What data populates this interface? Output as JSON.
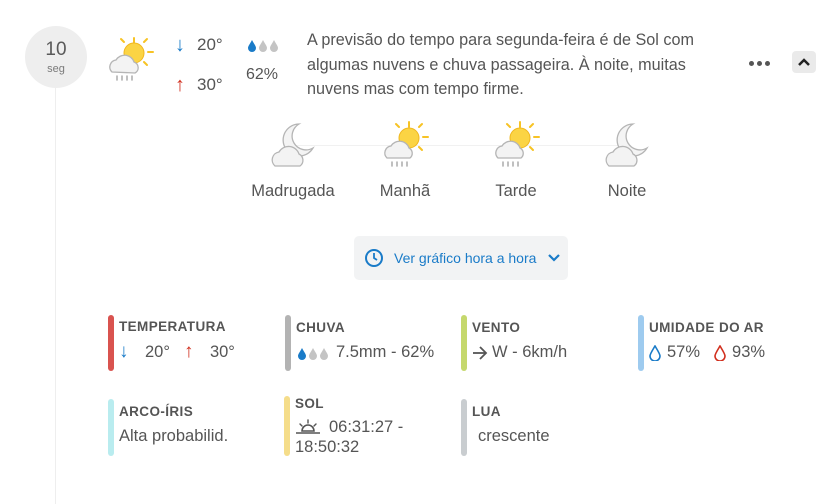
{
  "day": {
    "number": "10",
    "name": "seg"
  },
  "summary": {
    "icon": "sun-cloud-rain-icon",
    "min_temp": "20°",
    "max_temp": "30°",
    "rain_probability": "62%",
    "description": "A previsão do tempo para segunda-feira é de Sol com algumas nuvens e chuva passageira. À noite, muitas nuvens mas com tempo firme."
  },
  "periods": [
    {
      "label": "Madrugada",
      "icon": "moon-cloud-icon"
    },
    {
      "label": "Manhã",
      "icon": "sun-cloud-rain-icon"
    },
    {
      "label": "Tarde",
      "icon": "sun-cloud-rain-icon"
    },
    {
      "label": "Noite",
      "icon": "moon-cloud-icon"
    }
  ],
  "hourly_button": {
    "label": "Ver gráfico hora a hora"
  },
  "stats": {
    "temperature": {
      "title": "TEMPERATURA",
      "min": "20°",
      "max": "30°",
      "color": "#d9534f"
    },
    "rain": {
      "title": "CHUVA",
      "value": "7.5mm - 62%",
      "color": "#b3b3b3"
    },
    "wind": {
      "title": "VENTO",
      "value": "W - 6km/h",
      "color": "#c5d86d"
    },
    "humidity": {
      "title": "UMIDADE DO AR",
      "min": "57%",
      "max": "93%",
      "color": "#9ecbef"
    },
    "rainbow": {
      "title": "ARCO-ÍRIS",
      "value": "Alta probabilid.",
      "color": "#b9ecef"
    },
    "sun": {
      "title": "SOL",
      "sunrise": "06:31:27 -",
      "sunset": "18:50:32",
      "color": "#f5dd8a"
    },
    "moon": {
      "title": "LUA",
      "value": "crescente",
      "color": "#c9cdd0"
    }
  },
  "colors": {
    "accent_blue": "#1a7bc8",
    "accent_red": "#d1301f",
    "sun": "#f7c325"
  }
}
